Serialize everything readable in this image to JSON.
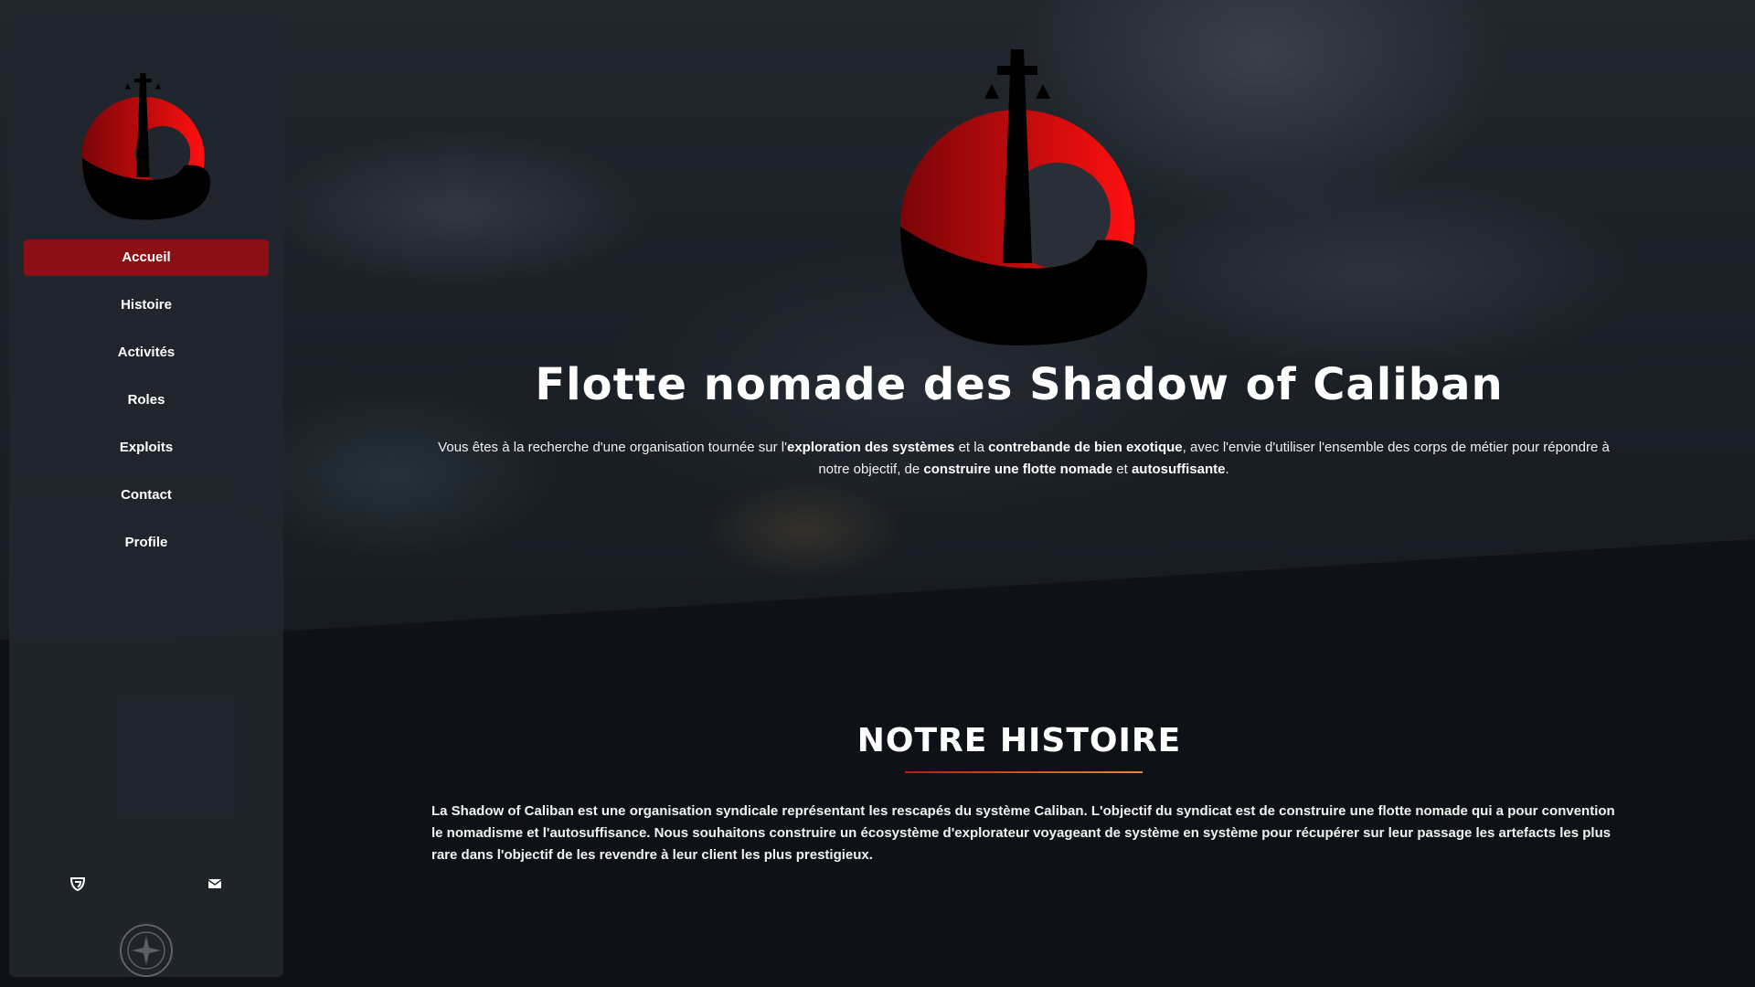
{
  "app": {
    "brand_colors": {
      "primary_red": "#e10f14",
      "dark": "#0e1117",
      "sidebar": "#21262e",
      "active_nav": "#8b1016"
    }
  },
  "sidebar": {
    "logo_icon": "caliban-rocket-logo",
    "nav": [
      {
        "label": "Accueil",
        "active": true
      },
      {
        "label": "Histoire",
        "active": false
      },
      {
        "label": "Activités",
        "active": false
      },
      {
        "label": "Roles",
        "active": false
      },
      {
        "label": "Exploits",
        "active": false
      },
      {
        "label": "Contact",
        "active": false
      },
      {
        "label": "Profile",
        "active": false
      }
    ],
    "footer_icons": [
      "guilded-icon",
      "envelope-icon"
    ],
    "badge_icon": "made-by-community-badge"
  },
  "hero": {
    "title": "Flotte nomade des Shadow of Caliban",
    "desc_1": "Vous êtes à la recherche d'une organisation tournée sur l'",
    "desc_b1": "exploration des systèmes",
    "desc_2": " et la ",
    "desc_b2": "contrebande de bien exotique",
    "desc_3": ", avec l'envie d'utiliser l'ensemble des corps de métier pour répondre à notre objectif, de ",
    "desc_b3": "construire une flotte nomade",
    "desc_4": " et ",
    "desc_b4": "autosuffisante",
    "desc_5": "."
  },
  "histoire": {
    "title": "NOTRE HISTOIRE",
    "text": "La Shadow of Caliban est une organisation syndicale représentant les rescapés du système Caliban. L'objectif du syndicat est de construire une flotte nomade qui a pour convention le nomadisme et l'autosuffisance. Nous souhaitons construire un écosystème d'explorateur voyageant de système en système pour récupérer sur leur passage les artefacts les plus rare dans l'objectif de les revendre à leur client les plus prestigieux."
  }
}
